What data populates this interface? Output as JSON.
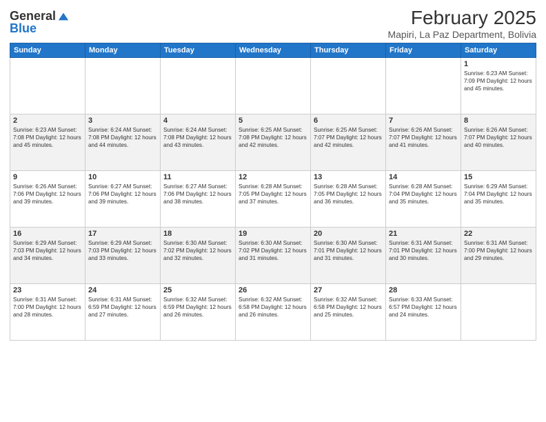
{
  "logo": {
    "general": "General",
    "blue": "Blue"
  },
  "title": "February 2025",
  "location": "Mapiri, La Paz Department, Bolivia",
  "days_of_week": [
    "Sunday",
    "Monday",
    "Tuesday",
    "Wednesday",
    "Thursday",
    "Friday",
    "Saturday"
  ],
  "weeks": [
    [
      {
        "day": "",
        "info": ""
      },
      {
        "day": "",
        "info": ""
      },
      {
        "day": "",
        "info": ""
      },
      {
        "day": "",
        "info": ""
      },
      {
        "day": "",
        "info": ""
      },
      {
        "day": "",
        "info": ""
      },
      {
        "day": "1",
        "info": "Sunrise: 6:23 AM\nSunset: 7:09 PM\nDaylight: 12 hours and 45 minutes."
      }
    ],
    [
      {
        "day": "2",
        "info": "Sunrise: 6:23 AM\nSunset: 7:08 PM\nDaylight: 12 hours and 45 minutes."
      },
      {
        "day": "3",
        "info": "Sunrise: 6:24 AM\nSunset: 7:08 PM\nDaylight: 12 hours and 44 minutes."
      },
      {
        "day": "4",
        "info": "Sunrise: 6:24 AM\nSunset: 7:08 PM\nDaylight: 12 hours and 43 minutes."
      },
      {
        "day": "5",
        "info": "Sunrise: 6:25 AM\nSunset: 7:08 PM\nDaylight: 12 hours and 42 minutes."
      },
      {
        "day": "6",
        "info": "Sunrise: 6:25 AM\nSunset: 7:07 PM\nDaylight: 12 hours and 42 minutes."
      },
      {
        "day": "7",
        "info": "Sunrise: 6:26 AM\nSunset: 7:07 PM\nDaylight: 12 hours and 41 minutes."
      },
      {
        "day": "8",
        "info": "Sunrise: 6:26 AM\nSunset: 7:07 PM\nDaylight: 12 hours and 40 minutes."
      }
    ],
    [
      {
        "day": "9",
        "info": "Sunrise: 6:26 AM\nSunset: 7:06 PM\nDaylight: 12 hours and 39 minutes."
      },
      {
        "day": "10",
        "info": "Sunrise: 6:27 AM\nSunset: 7:06 PM\nDaylight: 12 hours and 39 minutes."
      },
      {
        "day": "11",
        "info": "Sunrise: 6:27 AM\nSunset: 7:06 PM\nDaylight: 12 hours and 38 minutes."
      },
      {
        "day": "12",
        "info": "Sunrise: 6:28 AM\nSunset: 7:05 PM\nDaylight: 12 hours and 37 minutes."
      },
      {
        "day": "13",
        "info": "Sunrise: 6:28 AM\nSunset: 7:05 PM\nDaylight: 12 hours and 36 minutes."
      },
      {
        "day": "14",
        "info": "Sunrise: 6:28 AM\nSunset: 7:04 PM\nDaylight: 12 hours and 35 minutes."
      },
      {
        "day": "15",
        "info": "Sunrise: 6:29 AM\nSunset: 7:04 PM\nDaylight: 12 hours and 35 minutes."
      }
    ],
    [
      {
        "day": "16",
        "info": "Sunrise: 6:29 AM\nSunset: 7:03 PM\nDaylight: 12 hours and 34 minutes."
      },
      {
        "day": "17",
        "info": "Sunrise: 6:29 AM\nSunset: 7:03 PM\nDaylight: 12 hours and 33 minutes."
      },
      {
        "day": "18",
        "info": "Sunrise: 6:30 AM\nSunset: 7:02 PM\nDaylight: 12 hours and 32 minutes."
      },
      {
        "day": "19",
        "info": "Sunrise: 6:30 AM\nSunset: 7:02 PM\nDaylight: 12 hours and 31 minutes."
      },
      {
        "day": "20",
        "info": "Sunrise: 6:30 AM\nSunset: 7:01 PM\nDaylight: 12 hours and 31 minutes."
      },
      {
        "day": "21",
        "info": "Sunrise: 6:31 AM\nSunset: 7:01 PM\nDaylight: 12 hours and 30 minutes."
      },
      {
        "day": "22",
        "info": "Sunrise: 6:31 AM\nSunset: 7:00 PM\nDaylight: 12 hours and 29 minutes."
      }
    ],
    [
      {
        "day": "23",
        "info": "Sunrise: 6:31 AM\nSunset: 7:00 PM\nDaylight: 12 hours and 28 minutes."
      },
      {
        "day": "24",
        "info": "Sunrise: 6:31 AM\nSunset: 6:59 PM\nDaylight: 12 hours and 27 minutes."
      },
      {
        "day": "25",
        "info": "Sunrise: 6:32 AM\nSunset: 6:59 PM\nDaylight: 12 hours and 26 minutes."
      },
      {
        "day": "26",
        "info": "Sunrise: 6:32 AM\nSunset: 6:58 PM\nDaylight: 12 hours and 26 minutes."
      },
      {
        "day": "27",
        "info": "Sunrise: 6:32 AM\nSunset: 6:58 PM\nDaylight: 12 hours and 25 minutes."
      },
      {
        "day": "28",
        "info": "Sunrise: 6:33 AM\nSunset: 6:57 PM\nDaylight: 12 hours and 24 minutes."
      },
      {
        "day": "",
        "info": ""
      }
    ]
  ]
}
